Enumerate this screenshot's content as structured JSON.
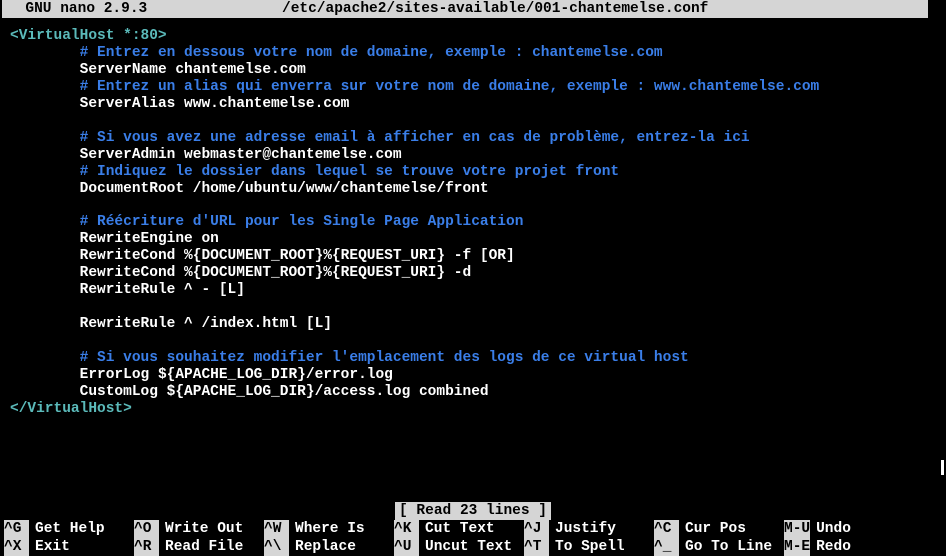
{
  "titlebar": {
    "app": "  GNU nano 2.9.3",
    "file": "/etc/apache2/sites-available/001-chantemelse.conf"
  },
  "lines": [
    {
      "indent": "",
      "class": "tag",
      "text": "<VirtualHost *:80>"
    },
    {
      "indent": "        ",
      "class": "comment",
      "text": "# Entrez en dessous votre nom de domaine, exemple : chantemelse.com"
    },
    {
      "indent": "        ",
      "class": "text",
      "text": "ServerName chantemelse.com"
    },
    {
      "indent": "        ",
      "class": "comment",
      "text": "# Entrez un alias qui enverra sur votre nom de domaine, exemple : www.chantemelse.com"
    },
    {
      "indent": "        ",
      "class": "text",
      "text": "ServerAlias www.chantemelse.com"
    },
    {
      "indent": "",
      "class": "text",
      "text": ""
    },
    {
      "indent": "        ",
      "class": "comment",
      "text": "# Si vous avez une adresse email à afficher en cas de problème, entrez-la ici"
    },
    {
      "indent": "        ",
      "class": "text",
      "text": "ServerAdmin webmaster@chantemelse.com"
    },
    {
      "indent": "        ",
      "class": "comment",
      "text": "# Indiquez le dossier dans lequel se trouve votre projet front"
    },
    {
      "indent": "        ",
      "class": "text",
      "text": "DocumentRoot /home/ubuntu/www/chantemelse/front"
    },
    {
      "indent": "",
      "class": "text",
      "text": ""
    },
    {
      "indent": "        ",
      "class": "comment",
      "text": "# Réécriture d'URL pour les Single Page Application"
    },
    {
      "indent": "        ",
      "class": "text",
      "text": "RewriteEngine on"
    },
    {
      "indent": "        ",
      "class": "text",
      "text": "RewriteCond %{DOCUMENT_ROOT}%{REQUEST_URI} -f [OR]"
    },
    {
      "indent": "        ",
      "class": "text",
      "text": "RewriteCond %{DOCUMENT_ROOT}%{REQUEST_URI} -d"
    },
    {
      "indent": "        ",
      "class": "text",
      "text": "RewriteRule ^ - [L]"
    },
    {
      "indent": "",
      "class": "text",
      "text": ""
    },
    {
      "indent": "        ",
      "class": "text",
      "text": "RewriteRule ^ /index.html [L]"
    },
    {
      "indent": "",
      "class": "text",
      "text": ""
    },
    {
      "indent": "        ",
      "class": "comment",
      "text": "# Si vous souhaitez modifier l'emplacement des logs de ce virtual host"
    },
    {
      "indent": "        ",
      "class": "text",
      "text": "ErrorLog ${APACHE_LOG_DIR}/error.log"
    },
    {
      "indent": "        ",
      "class": "text",
      "text": "CustomLog ${APACHE_LOG_DIR}/access.log combined"
    },
    {
      "indent": "",
      "class": "tag",
      "text": "</VirtualHost>"
    }
  ],
  "status": "[ Read 23 lines ]",
  "shortcuts": {
    "row1": [
      {
        "key": "^G",
        "label": "Get Help"
      },
      {
        "key": "^O",
        "label": "Write Out"
      },
      {
        "key": "^W",
        "label": "Where Is"
      },
      {
        "key": "^K",
        "label": "Cut Text"
      },
      {
        "key": "^J",
        "label": "Justify"
      },
      {
        "key": "^C",
        "label": "Cur Pos"
      },
      {
        "key": "M-U",
        "label": "Undo"
      }
    ],
    "row2": [
      {
        "key": "^X",
        "label": "Exit"
      },
      {
        "key": "^R",
        "label": "Read File"
      },
      {
        "key": "^\\",
        "label": "Replace"
      },
      {
        "key": "^U",
        "label": "Uncut Text"
      },
      {
        "key": "^T",
        "label": "To Spell"
      },
      {
        "key": "^_",
        "label": "Go To Line"
      },
      {
        "key": "M-E",
        "label": "Redo"
      }
    ]
  }
}
